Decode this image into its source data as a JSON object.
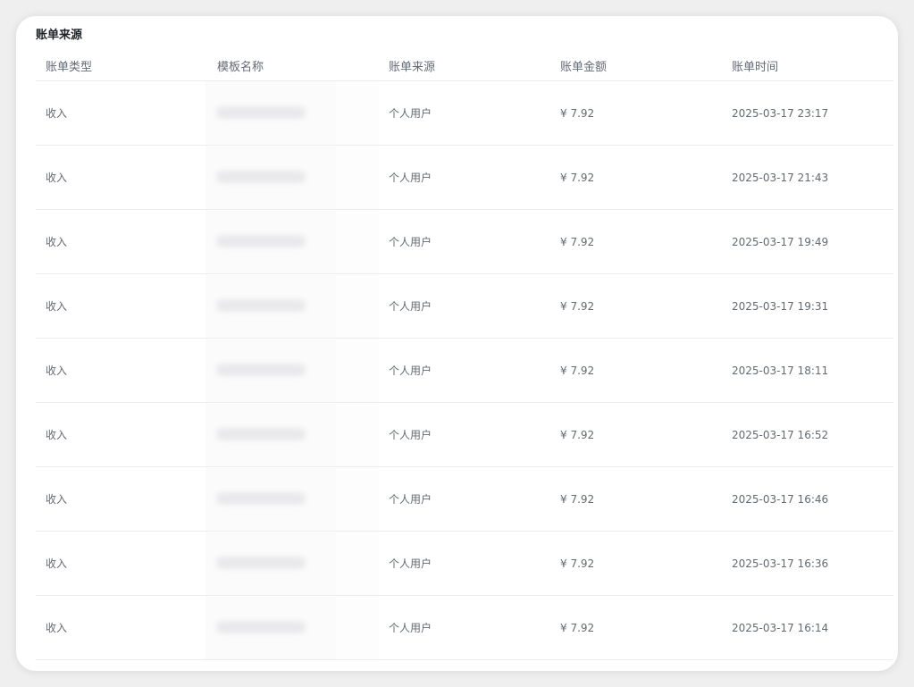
{
  "card": {
    "title": "账单来源"
  },
  "table": {
    "columns": [
      "账单类型",
      "模板名称",
      "账单来源",
      "账单金额",
      "账单时间"
    ],
    "rows": [
      {
        "type": "收入",
        "source": "个人用户",
        "amount": "¥ 7.92",
        "time": "2025-03-17 23:17"
      },
      {
        "type": "收入",
        "source": "个人用户",
        "amount": "¥ 7.92",
        "time": "2025-03-17 21:43"
      },
      {
        "type": "收入",
        "source": "个人用户",
        "amount": "¥ 7.92",
        "time": "2025-03-17 19:49"
      },
      {
        "type": "收入",
        "source": "个人用户",
        "amount": "¥ 7.92",
        "time": "2025-03-17 19:31"
      },
      {
        "type": "收入",
        "source": "个人用户",
        "amount": "¥ 7.92",
        "time": "2025-03-17 18:11"
      },
      {
        "type": "收入",
        "source": "个人用户",
        "amount": "¥ 7.92",
        "time": "2025-03-17 16:52"
      },
      {
        "type": "收入",
        "source": "个人用户",
        "amount": "¥ 7.92",
        "time": "2025-03-17 16:46"
      },
      {
        "type": "收入",
        "source": "个人用户",
        "amount": "¥ 7.92",
        "time": "2025-03-17 16:36"
      },
      {
        "type": "收入",
        "source": "个人用户",
        "amount": "¥ 7.92",
        "time": "2025-03-17 16:14"
      }
    ]
  }
}
